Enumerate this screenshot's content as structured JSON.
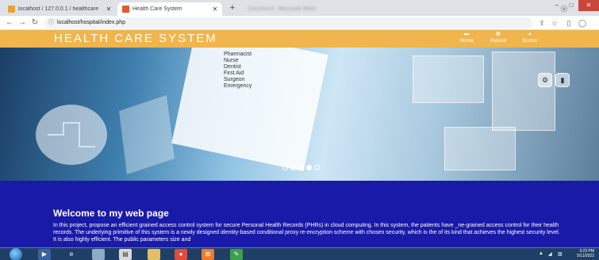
{
  "browser": {
    "tabs": [
      {
        "title": "localhost / 127.0.0.1 / healthcare",
        "favicon_color": "#e8a23a"
      },
      {
        "title": "Health Care System",
        "favicon_color": "#e25b2c"
      }
    ],
    "background_tab": "Document - Microsoft Word",
    "url": "localhost/hospital/index.php"
  },
  "site": {
    "title": "HEALTH CARE SYSTEM",
    "nav": [
      {
        "label": "Home",
        "icon": "home-icon"
      },
      {
        "label": "Patient",
        "icon": "patient-icon"
      },
      {
        "label": "Doctor",
        "icon": "doctor-icon"
      }
    ]
  },
  "hero": {
    "professions": [
      "Pharmacist",
      "Nurse",
      "Dentist",
      "First Aid",
      "Surgeon",
      "Emergency"
    ],
    "slides_total": 5,
    "active_slide": 4
  },
  "content": {
    "heading": "Welcome to my web page",
    "body": "In this project, propose an efficient grained access control system for secure Personal Health Records (PHRs) in cloud computing. In this system, the patients have _ne-grained access control for their health records. The underlying primitive of this system is a newly designed identity-based conditional proxy re-encryption scheme with chosen security, which is the of its kind that achieves the highest security level. It is also highly efficient. The public parameters size and"
  },
  "taskbar": {
    "time": "3:23 PM",
    "date": "5/11/2022"
  },
  "colors": {
    "header": "#f0b54c",
    "content_bg": "#1a1aa8",
    "taskbar": "#1f3f66"
  }
}
